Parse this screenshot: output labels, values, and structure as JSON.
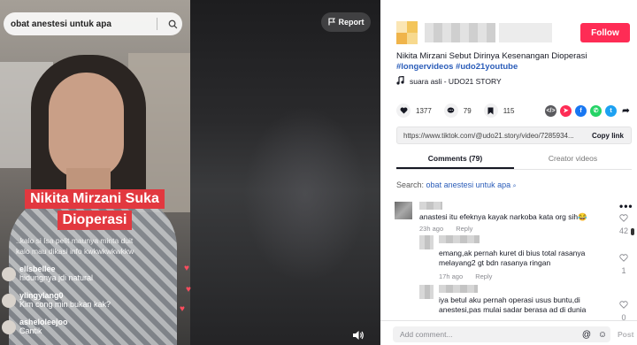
{
  "video": {
    "search_query": "obat anestesi untuk apa",
    "report_label": "Report",
    "overlay_title_line1": "Nikita Mirzani Suka",
    "overlay_title_line2": "Dioperasi",
    "caption_line1": "..kalo si Isa pelit maunya minta duit",
    "caption_line2": "kalo mau dikasi info kwkwkwkwkkw",
    "live_comments": [
      {
        "user": "ellsbellee",
        "message": "hidungnya jdi natural"
      },
      {
        "user": "ylingylang0",
        "message": "Kim cong min bukan kak?"
      },
      {
        "user": "asheloleejoo",
        "message": "Cantik"
      }
    ]
  },
  "panel": {
    "follow_label": "Follow",
    "description": "Nikita Mirzani Sebut Dirinya Kesenangan Dioperasi",
    "hashtags": "#longervideos #udo21youtube",
    "music": "suara asli - UDO21 STORY",
    "likes": "1377",
    "comments_count": "79",
    "saves": "115",
    "link_url": "https://www.tiktok.com/@udo21.story/video/7285934...",
    "copy_link_label": "Copy link",
    "tab_comments": "Comments (79)",
    "tab_creator_videos": "Creator videos",
    "search_hint_prefix": "Search:",
    "search_hint_query": "obat anestesi untuk apa",
    "comments": [
      {
        "text": "anastesi itu efeknya kayak narkoba kata org sih😂",
        "time": "23h ago",
        "reply": "Reply",
        "likes": "42"
      },
      {
        "text": "emang,ak pernah kuret di bius total rasanya melayang2 gt bdn rasanya ringan",
        "time": "17h ago",
        "reply": "Reply",
        "likes": "1"
      },
      {
        "text": "iya betul aku pernah operasi usus buntu,di anestesi,pas mulai sadar berasa ad di dunia",
        "time": "",
        "reply": "",
        "likes": "0"
      }
    ],
    "add_comment_placeholder": "Add comment...",
    "post_label": "Post"
  },
  "colors": {
    "brand_red": "#fe2c55",
    "hashtag_blue": "#2b5db9",
    "overlay_title_bg": "#e2383f"
  },
  "icons": [
    "search-icon",
    "flag-icon",
    "volume-icon",
    "heart-icon",
    "comment-icon",
    "bookmark-icon",
    "embed-icon",
    "share-icons",
    "music-note-icon",
    "at-icon",
    "emoji-icon",
    "more-icon"
  ]
}
